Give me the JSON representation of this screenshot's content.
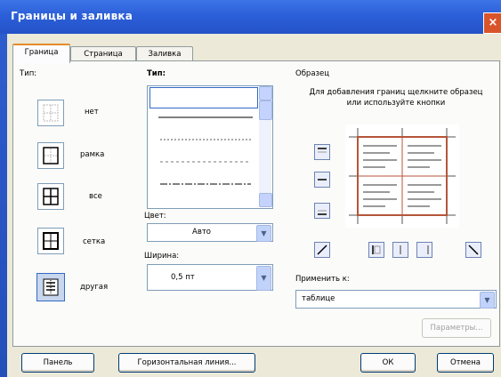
{
  "window": {
    "title": "Границы и заливка",
    "close_icon": "×"
  },
  "tabs": [
    {
      "label": "Граница",
      "active": true
    },
    {
      "label": "Страница"
    },
    {
      "label": "Заливка"
    }
  ],
  "type_section": {
    "label": "Тип:",
    "options": [
      {
        "label": "нет",
        "icon": "none-icon"
      },
      {
        "label": "рамка",
        "icon": "box-icon"
      },
      {
        "label": "все",
        "icon": "all-icon"
      },
      {
        "label": "сетка",
        "icon": "grid-icon"
      },
      {
        "label": "другая",
        "icon": "custom-icon",
        "selected": true
      }
    ]
  },
  "style_section": {
    "label": "Тип:",
    "color_label": "Цвет:",
    "color_value": "Авто",
    "width_label": "Ширина:",
    "width_value": "0,5 пт"
  },
  "preview_section": {
    "label": "Образец",
    "hint": "Для добавления границ щелкните образец или используйте кнопки",
    "apply_label": "Применить к:",
    "apply_value": "таблице",
    "params_button": "Параметры..."
  },
  "footer": {
    "panel_button": "Панель",
    "hline_button": "Горизонтальная линия...",
    "ok_button": "ОК",
    "cancel_button": "Отмена"
  },
  "colors": {
    "accent": "#e68b2c",
    "titlebar": "#2b5fd8",
    "dialog": "#ece9d8",
    "close": "#d9542b",
    "border_preview": "#b5553a"
  }
}
